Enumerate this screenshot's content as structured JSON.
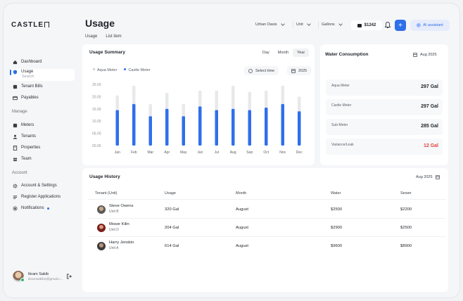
{
  "app": {
    "logo": "CASTLE"
  },
  "sidebar": {
    "items": [
      {
        "label": "Dashboard",
        "icon": "home-icon"
      },
      {
        "label": "Usage",
        "icon": "shield-icon"
      },
      {
        "label": "Tenant Bills",
        "icon": "bill-icon"
      },
      {
        "label": "Payables",
        "icon": "card-icon"
      }
    ],
    "search_placeholder": "Search",
    "manage_title": "Manage",
    "manage_items": [
      {
        "label": "Meters",
        "icon": "meter-icon"
      },
      {
        "label": "Tenants",
        "icon": "users-icon"
      },
      {
        "label": "Properties",
        "icon": "building-icon"
      },
      {
        "label": "Team",
        "icon": "team-icon"
      }
    ],
    "account_title": "Account",
    "account_items": [
      {
        "label": "Account & Settings",
        "icon": "gear-icon"
      },
      {
        "label": "Register Applications",
        "icon": "apps-icon"
      },
      {
        "label": "Notifications",
        "icon": "bell-icon"
      }
    ],
    "user": {
      "name": "Ikram Sakib",
      "email": "ikramsakib2@gmail.c..."
    }
  },
  "header": {
    "title": "Usage",
    "tabs": [
      "Usage",
      "List item"
    ],
    "filters": {
      "location": "Urban Oasis",
      "unit": "Unit",
      "measure": "Gallons"
    },
    "wallet": "$1242",
    "ai_label": "AI assistant"
  },
  "usage_summary": {
    "title": "Usage Summary",
    "periods": [
      "Day",
      "Month",
      "Year"
    ],
    "selected_period": "Year",
    "legend": [
      "Aqua Meter",
      "Castle Meter"
    ],
    "time_label": "Select time",
    "year": "2025"
  },
  "chart_data": {
    "type": "bar",
    "categories": [
      "Jan",
      "Feb",
      "Mar",
      "Apr",
      "May",
      "Jun",
      "Jul",
      "Aug",
      "Sep",
      "Oct",
      "Nov",
      "Dec"
    ],
    "yticks": [
      "25.00",
      "20.00",
      "15.00",
      "10.00",
      "05.00",
      "00.00"
    ],
    "ylim": [
      0,
      25
    ],
    "series": [
      {
        "name": "Aqua Meter",
        "values": [
          20.5,
          24.5,
          17,
          21.5,
          17,
          22.5,
          22.5,
          24.5,
          22,
          22.5,
          24.5,
          20
        ],
        "color": "#e8e9eb"
      },
      {
        "name": "Castle Meter",
        "values": [
          14.5,
          17,
          12,
          15,
          12,
          16,
          14.5,
          15,
          14.5,
          15.5,
          17,
          14
        ],
        "color": "#2f6fea"
      }
    ]
  },
  "water": {
    "title": "Water Consumption",
    "period": "Aug 2025",
    "rows": [
      {
        "label": "Aqua Meter",
        "value": "297 Gal",
        "color": "#1f2329"
      },
      {
        "label": "Castle Meter",
        "value": "297 Gal",
        "color": "#1f2329"
      },
      {
        "label": "Sub-Meter",
        "value": "285 Gal",
        "color": "#1f2329"
      },
      {
        "label": "Variance/Leak",
        "value": "12 Gal",
        "color": "#e0433a"
      }
    ]
  },
  "history": {
    "title": "Usage History",
    "period": "Aug 2025",
    "columns": [
      "Tenant (Unit)",
      "Usage",
      "Month",
      "Water",
      "Sewer"
    ],
    "rows": [
      {
        "name": "Steve Owens",
        "unit": "Unit B",
        "usage": "320 Gal",
        "month": "August",
        "water": "$2500",
        "sewer": "$2200"
      },
      {
        "name": "Moser Kilin",
        "unit": "Unit D",
        "usage": "204 Gal",
        "month": "August",
        "water": "$2900",
        "sewer": "$2500"
      },
      {
        "name": "Harry Jenskin",
        "unit": "Unit A",
        "usage": "614 Gal",
        "month": "August",
        "water": "$9600",
        "sewer": "$8900"
      }
    ]
  }
}
